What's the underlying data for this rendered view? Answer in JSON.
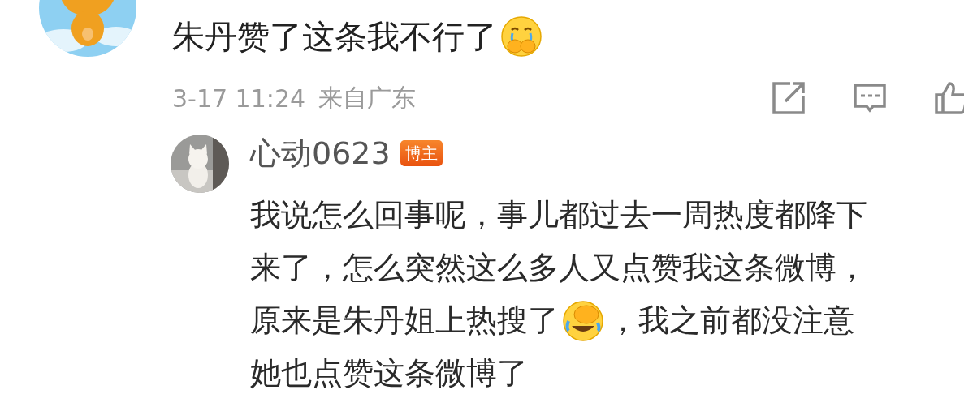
{
  "comment": {
    "text": "朱丹赞了这条我不行了",
    "time": "3-17 11:24",
    "location": "来自广东"
  },
  "reply": {
    "author": "心动0623",
    "badge": "博主",
    "lines": [
      [
        {
          "kind": "text",
          "text": "我说怎么回事呢，事儿都过去一周热度都降下"
        }
      ],
      [
        {
          "kind": "text",
          "text": "来了，怎么突然这么多人又点赞我这条微博，"
        }
      ],
      [
        {
          "kind": "text",
          "text": "原来是朱丹姐上热搜了"
        },
        {
          "kind": "emoji"
        },
        {
          "kind": "text",
          "text": "，我之前都没注意"
        }
      ],
      [
        {
          "kind": "text",
          "text": "她也点赞这条微博了"
        }
      ]
    ]
  }
}
